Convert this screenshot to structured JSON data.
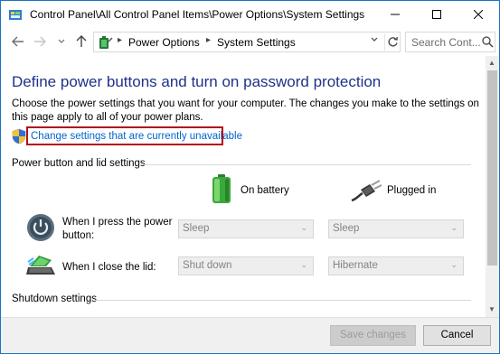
{
  "window": {
    "title": "Control Panel\\All Control Panel Items\\Power Options\\System Settings"
  },
  "address_bar": {
    "crumbs": [
      "Power Options",
      "System Settings"
    ],
    "search_placeholder": "Search Cont..."
  },
  "content": {
    "heading": "Define power buttons and turn on password protection",
    "description": "Choose the power settings that you want for your computer. The changes you make to the settings on this page apply to all of your power plans.",
    "change_link": "Change settings that are currently unavailable",
    "section_power": "Power button and lid settings",
    "section_shutdown": "Shutdown settings",
    "columns": {
      "battery": "On battery",
      "plugged": "Plugged in"
    },
    "rows": [
      {
        "label": "When I press the power button:",
        "on_battery": "Sleep",
        "plugged_in": "Sleep"
      },
      {
        "label": "When I close the lid:",
        "on_battery": "Shut down",
        "plugged_in": "Hibernate"
      }
    ]
  },
  "footer": {
    "save_label": "Save changes",
    "cancel_label": "Cancel"
  },
  "icons": {
    "window": "control-panel-icon",
    "shield": "uac-shield-icon",
    "battery": "battery-icon",
    "plug": "power-plug-icon",
    "power": "power-button-icon",
    "lid": "laptop-lid-icon"
  },
  "colors": {
    "heading": "#1e3287",
    "link": "#0066cc",
    "highlight": "#b0111b",
    "window_border": "#1a73c4"
  }
}
